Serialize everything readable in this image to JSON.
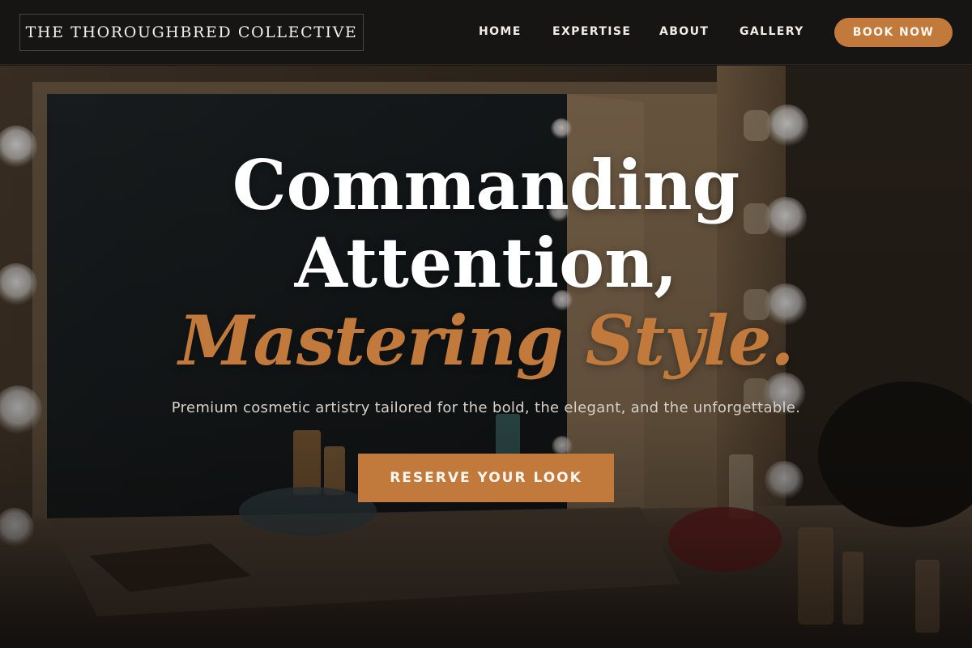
{
  "header": {
    "logo": "THE THOROUGHBRED COLLECTIVE",
    "nav": [
      "HOME",
      "EXPERTISE",
      "ABOUT",
      "GALLERY"
    ],
    "cta": "BOOK NOW"
  },
  "hero": {
    "headline_line1": "Commanding",
    "headline_line2": "Attention,",
    "headline_line3": "Mastering Style.",
    "tagline": "Premium cosmetic artistry tailored for the bold, the elegant, and the unforgettable.",
    "cta": "RESERVE YOUR LOOK"
  },
  "colors": {
    "accent": "#c17a3b",
    "header_bg": "#161514",
    "text_light": "#ffffff"
  },
  "icons": []
}
